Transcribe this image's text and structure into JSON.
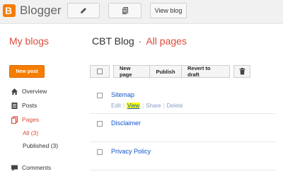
{
  "header": {
    "logo_text": "Blogger",
    "view_blog_label": "View blog"
  },
  "sidebar": {
    "heading": "My blogs",
    "new_post_label": "New post",
    "items": [
      {
        "label": "Overview",
        "icon": "home-icon"
      },
      {
        "label": "Posts",
        "icon": "posts-icon"
      },
      {
        "label": "Pages",
        "icon": "pages-icon",
        "active": true
      },
      {
        "label": "All (3)",
        "sub": true,
        "active": true
      },
      {
        "label": "Published (3)",
        "sub": true
      },
      {
        "label": "Comments",
        "icon": "comments-icon"
      }
    ]
  },
  "main": {
    "blog_name": "CBT Blog",
    "separator": "·",
    "section": "All pages",
    "toolbar": {
      "new_page": "New page",
      "publish": "Publish",
      "revert": "Revert to draft",
      "delete_icon": "trash-icon"
    },
    "pages": [
      {
        "title": "Sitemap",
        "actions": [
          "Edit",
          "View",
          "Share",
          "Delete"
        ]
      },
      {
        "title": "Disclaimer"
      },
      {
        "title": "Privacy Policy"
      }
    ]
  },
  "colors": {
    "accent": "#f57d00",
    "heading_red": "#dd4b39",
    "link_blue": "#1155cc"
  }
}
